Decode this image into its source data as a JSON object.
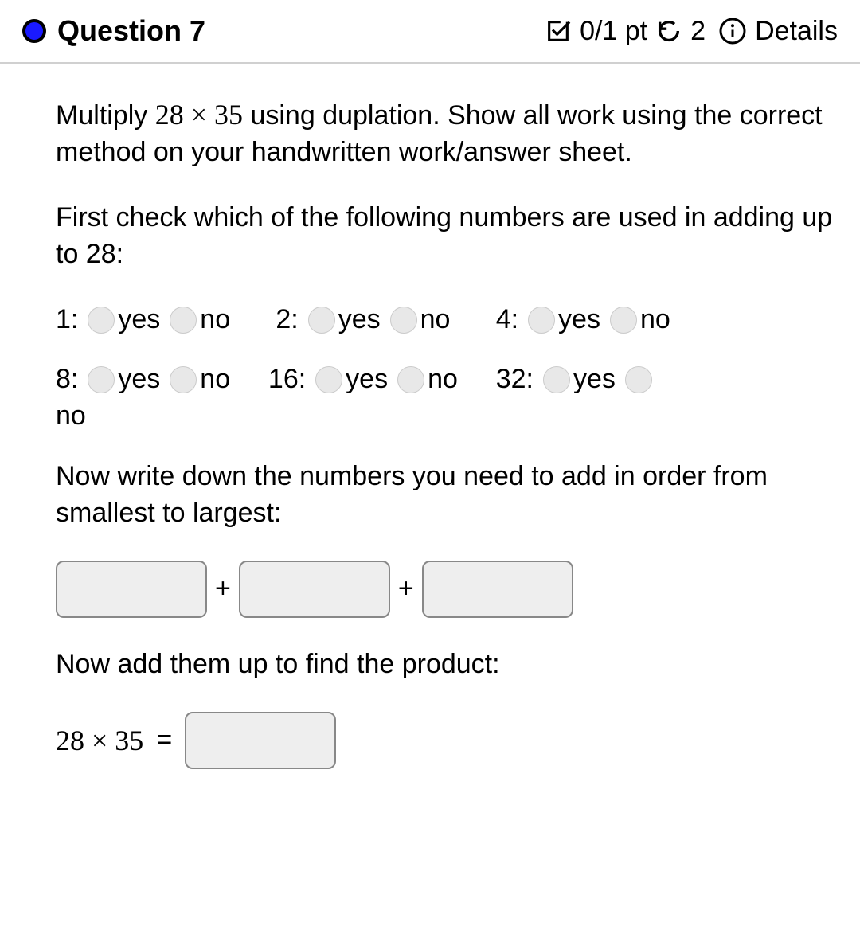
{
  "header": {
    "title": "Question 7",
    "points": "0/1 pt",
    "attempts": "2",
    "details_label": "Details"
  },
  "prompt": {
    "line1_prefix": "Multiply ",
    "expr": "28 × 35",
    "line1_suffix": " using duplation.  Show all work using the correct method on your handwritten work/answer sheet.",
    "line2": "First check which of the following numbers are used in adding up to 28:"
  },
  "radios": {
    "yes": "yes",
    "no": "no",
    "labels": {
      "r1": "1:",
      "r2": "2:",
      "r4": "4:",
      "r8": "8:",
      "r16": "16:",
      "r32": "32:"
    }
  },
  "instr2": "Now write down the numbers you need to add in order from smallest to largest:",
  "plus": "+",
  "instr3": "Now add them up to find the product:",
  "final": {
    "lhs": "28 × 35",
    "eq": "="
  }
}
